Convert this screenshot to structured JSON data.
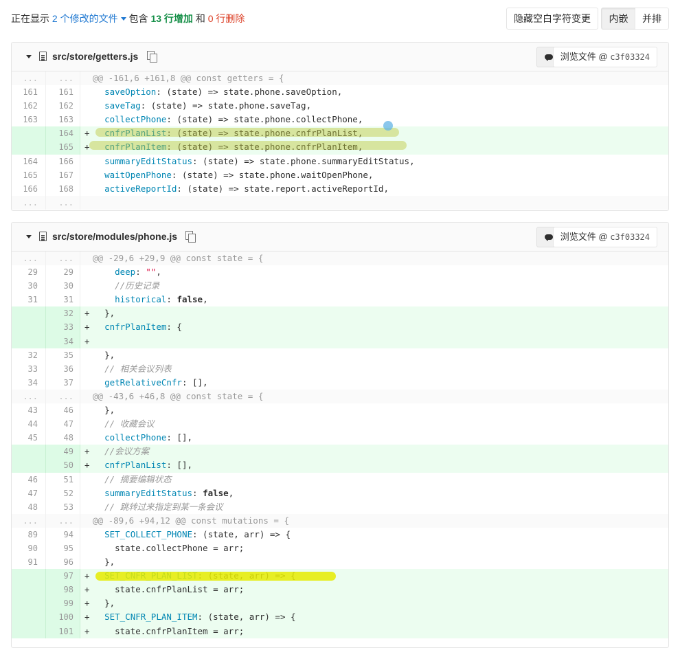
{
  "summary": {
    "prefix": "正在显示",
    "files_link": "2 个修改的文件",
    "includes": "包含",
    "additions": "13 行增加",
    "and": "和",
    "deletions": "0 行删除"
  },
  "toolbar": {
    "whitespace_label": "隐藏空白字符变更",
    "inline_label": "内嵌",
    "parallel_label": "并排"
  },
  "files": [
    {
      "path": "src/store/getters.js",
      "view_label": "浏览文件 @ ",
      "sha": "c3f03324",
      "lines": [
        {
          "type": "match",
          "old": "...",
          "new": "...",
          "text": "@@ -161,6 +161,8 @@ const getters = {"
        },
        {
          "type": "ctx",
          "old": "161",
          "new": "161",
          "prop": "saveOption",
          "rest": ": (state) => state.phone.saveOption,"
        },
        {
          "type": "ctx",
          "old": "162",
          "new": "162",
          "prop": "saveTag",
          "rest": ": (state) => state.phone.saveTag,"
        },
        {
          "type": "ctx",
          "old": "163",
          "new": "163",
          "prop": "collectPhone",
          "rest": ": (state) => state.phone.collectPhone,"
        },
        {
          "type": "add",
          "old": "",
          "new": "164",
          "prop": "cnfrPlanList",
          "rest": ": (state) => state.phone.cnfrPlanList,"
        },
        {
          "type": "add",
          "old": "",
          "new": "165",
          "prop": "cnfrPlanItem",
          "rest": ": (state) => state.phone.cnfrPlanItem,"
        },
        {
          "type": "ctx",
          "old": "164",
          "new": "166",
          "prop": "summaryEditStatus",
          "rest": ": (state) => state.phone.summaryEditStatus,"
        },
        {
          "type": "ctx",
          "old": "165",
          "new": "167",
          "prop": "waitOpenPhone",
          "rest": ": (state) => state.phone.waitOpenPhone,"
        },
        {
          "type": "ctx",
          "old": "166",
          "new": "168",
          "prop": "activeReportId",
          "rest": ": (state) => state.report.activeReportId,"
        },
        {
          "type": "match",
          "old": "...",
          "new": "...",
          "text": ""
        }
      ]
    },
    {
      "path": "src/store/modules/phone.js",
      "view_label": "浏览文件 @ ",
      "sha": "c3f03324",
      "lines": [
        {
          "type": "match",
          "old": "...",
          "new": "...",
          "text": "@@ -29,6 +29,9 @@ const state = {"
        },
        {
          "type": "ctx",
          "old": "29",
          "new": "29",
          "indent": "  ",
          "prop": "deep",
          "rest": ": ",
          "str": "\"\"",
          "tail": ","
        },
        {
          "type": "ctx",
          "old": "30",
          "new": "30",
          "indent": "  ",
          "comment": "//历史记录"
        },
        {
          "type": "ctx",
          "old": "31",
          "new": "31",
          "indent": "  ",
          "prop": "historical",
          "rest": ": ",
          "kw": "false",
          "tail": ","
        },
        {
          "type": "add",
          "old": "",
          "new": "32",
          "plain": "},"
        },
        {
          "type": "add",
          "old": "",
          "new": "33",
          "prop": "cnfrPlanItem",
          "rest": ": {"
        },
        {
          "type": "add",
          "old": "",
          "new": "34",
          "plain": ""
        },
        {
          "type": "ctx",
          "old": "32",
          "new": "35",
          "plain": "},"
        },
        {
          "type": "ctx",
          "old": "33",
          "new": "36",
          "comment": "// 相关会议列表"
        },
        {
          "type": "ctx",
          "old": "34",
          "new": "37",
          "prop": "getRelativeCnfr",
          "rest": ": [],"
        },
        {
          "type": "match",
          "old": "...",
          "new": "...",
          "text": "@@ -43,6 +46,8 @@ const state = {"
        },
        {
          "type": "ctx",
          "old": "43",
          "new": "46",
          "plain": "},"
        },
        {
          "type": "ctx",
          "old": "44",
          "new": "47",
          "comment": "// 收藏会议"
        },
        {
          "type": "ctx",
          "old": "45",
          "new": "48",
          "prop": "collectPhone",
          "rest": ": [],"
        },
        {
          "type": "add",
          "old": "",
          "new": "49",
          "comment": "//会议方案"
        },
        {
          "type": "add",
          "old": "",
          "new": "50",
          "prop": "cnfrPlanList",
          "rest": ": [],"
        },
        {
          "type": "ctx",
          "old": "46",
          "new": "51",
          "comment": "// 摘要编辑状态"
        },
        {
          "type": "ctx",
          "old": "47",
          "new": "52",
          "prop": "summaryEditStatus",
          "rest": ": ",
          "kw": "false",
          "tail": ","
        },
        {
          "type": "ctx",
          "old": "48",
          "new": "53",
          "comment": "// 跳转过来指定到某一条会议"
        },
        {
          "type": "match",
          "old": "...",
          "new": "...",
          "text": "@@ -89,6 +94,12 @@ const mutations = {"
        },
        {
          "type": "ctx",
          "old": "89",
          "new": "94",
          "prop": "SET_COLLECT_PHONE",
          "rest": ": (state, arr) => {"
        },
        {
          "type": "ctx",
          "old": "90",
          "new": "95",
          "indent": "  ",
          "plain": "state.collectPhone = arr;"
        },
        {
          "type": "ctx",
          "old": "91",
          "new": "96",
          "plain": "},"
        },
        {
          "type": "add",
          "old": "",
          "new": "97",
          "prop": "SET_CNFR_PLAN_LIST",
          "rest": ": (state, arr) => {"
        },
        {
          "type": "add",
          "old": "",
          "new": "98",
          "indent": "  ",
          "plain": "state.cnfrPlanList = arr;"
        },
        {
          "type": "add",
          "old": "",
          "new": "99",
          "plain": "},"
        },
        {
          "type": "add",
          "old": "",
          "new": "100",
          "prop": "SET_CNFR_PLAN_ITEM",
          "rest": ": (state, arr) => {"
        },
        {
          "type": "add",
          "old": "",
          "new": "101",
          "indent": "  ",
          "plain": "state.cnfrPlanItem = arr;"
        }
      ]
    }
  ]
}
